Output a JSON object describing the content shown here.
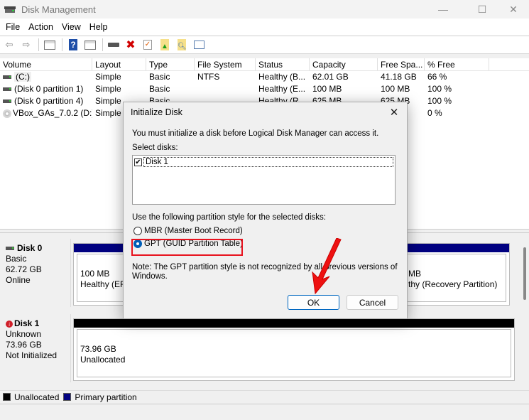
{
  "window": {
    "title": "Disk Management",
    "controls": {
      "minimize": "—",
      "maximize": "☐",
      "close": "✕"
    }
  },
  "menu": [
    "File",
    "Action",
    "View",
    "Help"
  ],
  "toolbar": {
    "icons": [
      "back-icon",
      "forward-icon",
      "show-hide-console-tree-icon",
      "help-icon",
      "show-hide-action-pane-icon",
      "connect-drive-icon",
      "delete-icon",
      "properties-icon",
      "export-list-icon",
      "rescan-icon",
      "settings-icon"
    ]
  },
  "volume_table": {
    "columns": [
      "Volume",
      "Layout",
      "Type",
      "File System",
      "Status",
      "Capacity",
      "Free Spa...",
      "% Free"
    ],
    "rows": [
      {
        "volume": "(C:)",
        "layout": "Simple",
        "type": "Basic",
        "fs": "NTFS",
        "status": "Healthy (B...",
        "capacity": "62.01 GB",
        "free": "41.18 GB",
        "pct": "66 %",
        "icon": "drive"
      },
      {
        "volume": "(Disk 0 partition 1)",
        "layout": "Simple",
        "type": "Basic",
        "fs": "",
        "status": "Healthy (E...",
        "capacity": "100 MB",
        "free": "100 MB",
        "pct": "100 %",
        "icon": "drive"
      },
      {
        "volume": "(Disk 0 partition 4)",
        "layout": "Simple",
        "type": "Basic",
        "fs": "",
        "status": "Healthy (R...",
        "capacity": "625 MB",
        "free": "625 MB",
        "pct": "100 %",
        "icon": "drive"
      },
      {
        "volume": "VBox_GAs_7.0.2 (D:)",
        "layout": "Simple",
        "type": "",
        "fs": "",
        "status": "",
        "capacity": "",
        "free": "",
        "pct": "0 %",
        "icon": "cd"
      }
    ]
  },
  "disks": [
    {
      "name": "Disk 0",
      "kind": "Basic",
      "size": "62.72 GB",
      "state": "Online",
      "partitions": [
        {
          "size": "100 MB",
          "status": "Healthy (EFI"
        },
        {
          "size": "MB",
          "status": "thy (Recovery Partition)"
        }
      ]
    },
    {
      "name": "Disk 1",
      "kind": "Unknown",
      "size": "73.96 GB",
      "state": "Not Initialized",
      "partitions": [
        {
          "size": "73.96 GB",
          "status": "Unallocated"
        }
      ]
    }
  ],
  "legend": [
    {
      "label": "Unallocated",
      "color": "#000000"
    },
    {
      "label": "Primary partition",
      "color": "#000080"
    }
  ],
  "dialog": {
    "title": "Initialize Disk",
    "message": "You must initialize a disk before Logical Disk Manager can access it.",
    "select_label": "Select disks:",
    "disk_items": [
      {
        "label": "Disk 1",
        "checked": true
      }
    ],
    "style_label": "Use the following partition style for the selected disks:",
    "options": [
      {
        "label": "MBR (Master Boot Record)",
        "selected": false
      },
      {
        "label": "GPT (GUID Partition Table)",
        "selected": true
      }
    ],
    "note": "Note: The GPT partition style is not recognized by all previous versions of Windows.",
    "ok": "OK",
    "cancel": "Cancel"
  },
  "colors": {
    "primary_partition": "#000080",
    "unallocated": "#000000",
    "highlight": "#e8121e",
    "accent": "#005fb8"
  }
}
